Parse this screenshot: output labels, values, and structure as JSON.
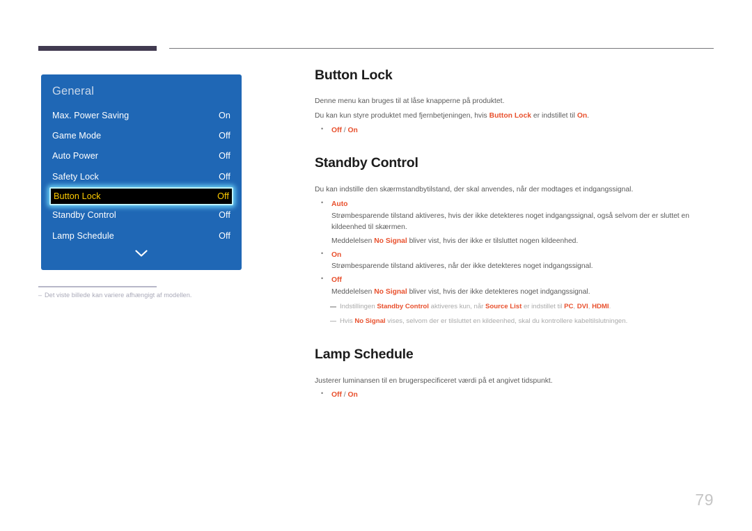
{
  "page": {
    "number": "79",
    "language": "da"
  },
  "figure": {
    "panel_title": "General",
    "rows": [
      {
        "label": "Max. Power Saving",
        "value": "On",
        "selected": false
      },
      {
        "label": "Game Mode",
        "value": "Off",
        "selected": false
      },
      {
        "label": "Auto Power",
        "value": "Off",
        "selected": false
      },
      {
        "label": "Safety Lock",
        "value": "Off",
        "selected": false
      },
      {
        "label": "Button Lock",
        "value": "Off",
        "selected": true
      },
      {
        "label": "Standby Control",
        "value": "Off",
        "selected": false
      },
      {
        "label": "Lamp Schedule",
        "value": "Off",
        "selected": false
      }
    ],
    "scroll_icon": "chevron-down-icon",
    "caption_dash": "–",
    "caption": "Det viste billede kan variere afhængigt af modellen."
  },
  "sections": [
    {
      "id": "button-lock",
      "title": "Button Lock",
      "paragraphs": [
        "Denne menu kan bruges til at låse knapperne på produktet.",
        "Du kan kun styre produktet med fjernbetjeningen, hvis Button Lock er indstillet til On."
      ],
      "options": [
        {
          "text": "Off / On",
          "parts": [
            "Off",
            " / ",
            "On"
          ]
        }
      ]
    },
    {
      "id": "standby-control",
      "title": "Standby Control",
      "paragraphs": [
        "Du kan indstille den skærmstandbytilstand, der skal anvendes, når der modtages et indgangssignal."
      ],
      "options": [
        {
          "name": "Auto",
          "lines": [
            "Strømbesparende tilstand aktiveres, hvis der ikke detekteres noget indgangssignal, også selvom der er sluttet en kildeenhed til skærmen.",
            "Meddelelsen No Signal bliver vist, hvis der ikke er tilsluttet nogen kildeenhed."
          ]
        },
        {
          "name": "On",
          "lines": [
            "Strømbesparende tilstand aktiveres, når der ikke detekteres noget indgangssignal."
          ]
        },
        {
          "name": "Off",
          "lines": [
            "Meddelelsen No Signal bliver vist, hvis der ikke detekteres noget indgangssignal."
          ]
        }
      ],
      "notes": [
        "Indstillingen Standby Control aktiveres kun, når Source List er indstillet til PC, DVI, HDMI.",
        "Hvis No Signal vises, selvom der er tilsluttet en kildeenhed, skal du kontrollere kabeltilslutningen."
      ]
    },
    {
      "id": "lamp-schedule",
      "title": "Lamp Schedule",
      "paragraphs": [
        "Justerer luminansen til en brugerspecificeret værdi på et angivet tidspunkt."
      ],
      "options": [
        {
          "text": "Off / On",
          "parts": [
            "Off",
            " / ",
            "On"
          ]
        }
      ]
    }
  ],
  "text_fragments": {
    "bl_p1": "Denne menu kan bruges til at låse knapperne på produktet.",
    "bl_p2_a": "Du kan kun styre produktet med fjernbetjeningen, hvis ",
    "bl_p2_b": "Button Lock",
    "bl_p2_c": " er indstillet til ",
    "bl_p2_d": "On",
    "bl_p2_e": ".",
    "bl_opt_off": "Off",
    "bl_opt_sep": " / ",
    "bl_opt_on": "On",
    "sc_p1": "Du kan indstille den skærmstandbytilstand, der skal anvendes, når der modtages et indgangssignal.",
    "sc_auto": "Auto",
    "sc_auto_l1": "Strømbesparende tilstand aktiveres, hvis der ikke detekteres noget indgangssignal, også selvom der er sluttet en kildeenhed til skærmen.",
    "sc_auto_l2_a": "Meddelelsen ",
    "sc_auto_l2_b": "No Signal",
    "sc_auto_l2_c": " bliver vist, hvis der ikke er tilsluttet nogen kildeenhed.",
    "sc_on": "On",
    "sc_on_l1": "Strømbesparende tilstand aktiveres, når der ikke detekteres noget indgangssignal.",
    "sc_off": "Off",
    "sc_off_l1_a": "Meddelelsen ",
    "sc_off_l1_b": "No Signal",
    "sc_off_l1_c": " bliver vist, hvis der ikke detekteres noget indgangssignal.",
    "note1_a": "Indstillingen ",
    "note1_b": "Standby Control",
    "note1_c": " aktiveres kun, når ",
    "note1_d": "Source List",
    "note1_e": " er indstillet til ",
    "note1_f": "PC",
    "note1_g": ", ",
    "note1_h": "DVI",
    "note1_i": ", ",
    "note1_j": "HDMI",
    "note1_k": ".",
    "note2_a": "Hvis ",
    "note2_b": "No Signal",
    "note2_c": " vises, selvom der er tilsluttet en kildeenhed, skal du kontrollere kabeltilslutningen.",
    "ls_p1": "Justerer luminansen til en brugerspecificeret værdi på et angivet tidspunkt.",
    "ls_opt_off": "Off",
    "ls_opt_sep": " / ",
    "ls_opt_on": "On"
  },
  "colors": {
    "accent": "#e8502d",
    "osd_blue": "#1f67b5",
    "osd_selected_bg": "#000000",
    "osd_selected_text": "#ffcc00",
    "osd_selected_border": "#bff3ff",
    "rule_dark": "#413a50",
    "page_number": "#c5c5c5"
  }
}
